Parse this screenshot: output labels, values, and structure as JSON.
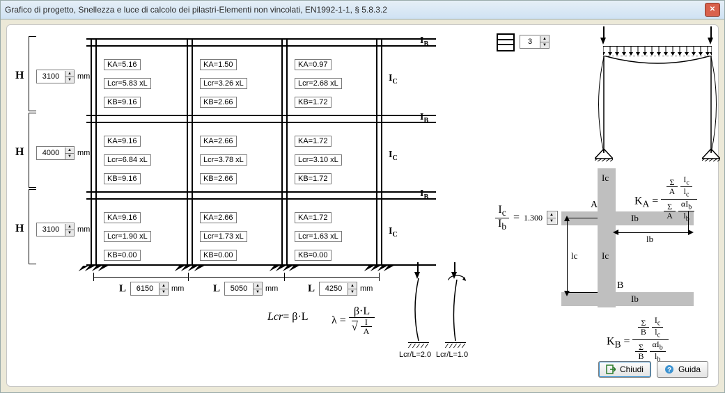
{
  "window": {
    "title": "Grafico di progetto, Snellezza e luce di calcolo dei pilastri-Elementi non vincolati,  EN1992-1-1, § 5.8.3.2"
  },
  "heights": {
    "H1": "3100",
    "H2": "4000",
    "H3": "3100",
    "unit": "mm",
    "label": "H"
  },
  "spans": {
    "L1": "6150",
    "L2": "5050",
    "L3": "4250",
    "unit": "mm",
    "label": "L"
  },
  "storeys_value": "3",
  "ratio": {
    "value": "1.300"
  },
  "labels": {
    "IB": "I",
    "IB_sub": "B",
    "IC": "I",
    "IC_sub": "C",
    "Ic": "I",
    "Ic_sub": "c",
    "Ib": "I",
    "Ib_sub": "b"
  },
  "cells": {
    "r1": {
      "c1": {
        "ka": "KA=5.16",
        "lcr": "Lcr=5.83 xL",
        "kb": "KB=9.16"
      },
      "c2": {
        "ka": "KA=1.50",
        "lcr": "Lcr=3.26 xL",
        "kb": "KB=2.66"
      },
      "c3": {
        "ka": "KA=0.97",
        "lcr": "Lcr=2.68 xL",
        "kb": "KB=1.72"
      }
    },
    "r2": {
      "c1": {
        "ka": "KA=9.16",
        "lcr": "Lcr=6.84 xL",
        "kb": "KB=9.16"
      },
      "c2": {
        "ka": "KA=2.66",
        "lcr": "Lcr=3.78 xL",
        "kb": "KB=2.66"
      },
      "c3": {
        "ka": "KA=1.72",
        "lcr": "Lcr=3.10 xL",
        "kb": "KB=1.72"
      }
    },
    "r3": {
      "c1": {
        "ka": "KA=9.16",
        "lcr": "Lcr=1.90 xL",
        "kb": "KB=0.00"
      },
      "c2": {
        "ka": "KA=2.66",
        "lcr": "Lcr=1.73 xL",
        "kb": "KB=0.00"
      },
      "c3": {
        "ka": "KA=1.72",
        "lcr": "Lcr=1.63 xL",
        "kb": "KB=0.00"
      }
    }
  },
  "formulas": {
    "lcr": "Lcr",
    "eq": "= β·L",
    "lambda": "λ =",
    "beta_l": "β·L",
    "sqrt_top": "I",
    "sqrt_bot": "A"
  },
  "pictos": {
    "left_caption": "Lcr/L=2.0",
    "right_caption": "Lcr/L=1.0"
  },
  "k_formulas": {
    "ka": "K",
    "ka_sub": "A",
    "kb": "K",
    "kb_sub": "B",
    "sum": "Σ",
    "Ic": "I",
    "Ic_sub": "c",
    "lc": "l",
    "lc_sub": "c",
    "Ib": "I",
    "Ib_sub": "b",
    "lb": "l",
    "lb_sub": "b",
    "alpha": "α",
    "A": "A",
    "B": "B"
  },
  "nodes": {
    "A": "A",
    "B": "B",
    "lb": "lb",
    "lc": "lc",
    "Ic": "Ic",
    "Ib": "Ib"
  },
  "buttons": {
    "close": "Chiudi",
    "help": "Guida"
  }
}
